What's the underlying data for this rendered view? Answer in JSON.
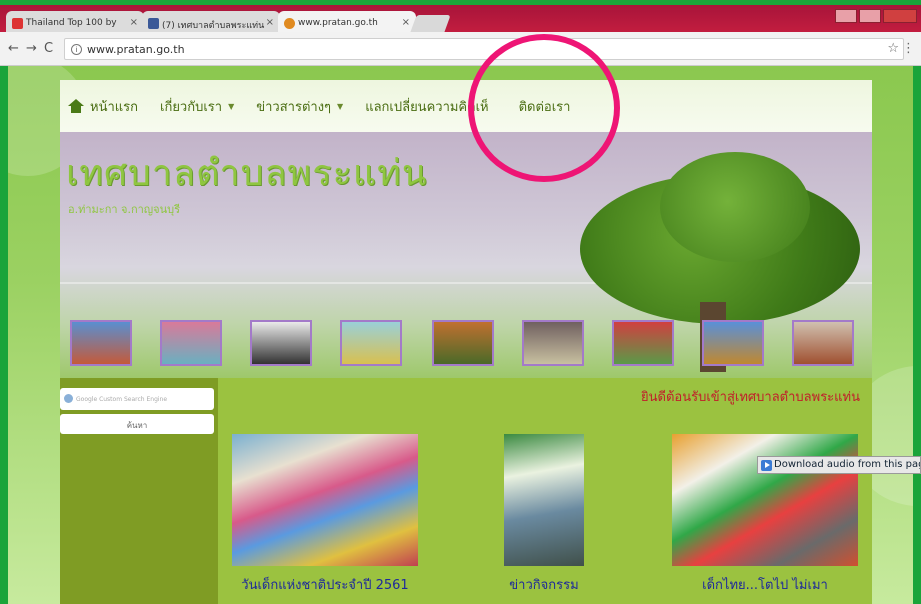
{
  "browser": {
    "tabs": [
      {
        "title": "Thailand Top 100 by",
        "active": false
      },
      {
        "title": "(7) เทศบาลตำบลพระแท่น",
        "active": false
      },
      {
        "title": "www.pratan.go.th",
        "active": true
      }
    ],
    "url": "www.pratan.go.th",
    "back_icon": "←",
    "forward_icon": "→",
    "reload_icon": "C",
    "info_icon": "i",
    "star_icon": "☆"
  },
  "nav": {
    "items": [
      {
        "label": "หน้าแรก",
        "has_dropdown": false
      },
      {
        "label": "เกี่ยวกับเรา",
        "has_dropdown": true
      },
      {
        "label": "ข่าวสารต่างๆ",
        "has_dropdown": true
      },
      {
        "label": "แลกเปลี่ยนความคิดเห็",
        "has_dropdown": false
      },
      {
        "label": "ติดต่อเรา",
        "has_dropdown": false
      }
    ],
    "caret": "▼"
  },
  "banner": {
    "title": "เทศบาลตำบลพระแท่น",
    "subtitle": "อ.ท่ามะกา จ.กาญจนบุรี"
  },
  "search": {
    "placeholder": "Google Custom Search Engine",
    "button_label": "ค้นหา"
  },
  "welcome_text": "ยินดีต้อนรับเข้าสู่เทศบาลตำบลพระแท่น",
  "cards": [
    {
      "caption": "วันเด็กแห่งชาติประจำปี 2561"
    },
    {
      "caption": "ข่าวกิจกรรม"
    },
    {
      "caption": "เด็กไทย...โตไป ไม่เมา"
    }
  ],
  "download_bar": {
    "label": "Download audio from this page"
  },
  "colors": {
    "annotation": "#ee1575",
    "nav_text": "#4a6d12",
    "welcome": "#c0202a",
    "caption": "#1e2a9a"
  }
}
